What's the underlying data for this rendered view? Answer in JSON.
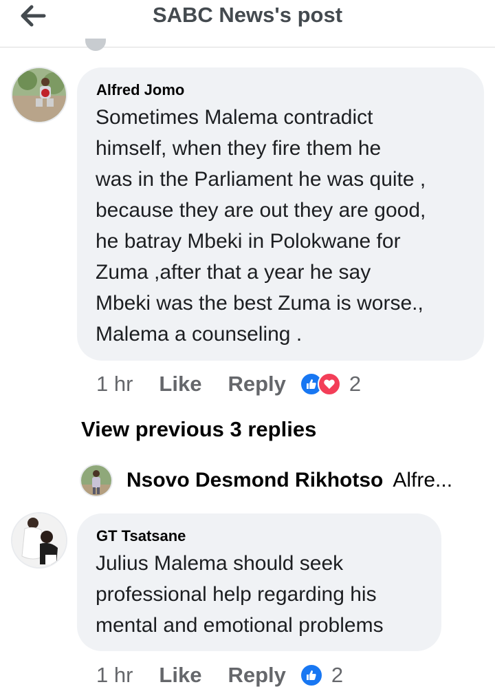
{
  "header": {
    "title": "SABC News's post",
    "back_icon": "arrow-left-icon"
  },
  "comments": [
    {
      "author": "Alfred Jomo",
      "text": "Sometimes Malema contradict\nhimself, when they fire them he\nwas in the Parliament he was quite ,\nbecause they are out they are good,\nhe batray Mbeki in Polokwane for\nZuma ,after that a year he say\nMbeki was the best Zuma is worse.,\nMalema a counseling .",
      "time": "1 hr",
      "like_label": "Like",
      "reply_label": "Reply",
      "reactions": [
        "like",
        "love"
      ],
      "reaction_count": "2"
    },
    {
      "author": "GT Tsatsane",
      "text": "Julius Malema should seek\nprofessional help regarding his\nmental and emotional problems",
      "time": "1 hr",
      "like_label": "Like",
      "reply_label": "Reply",
      "reactions": [
        "like"
      ],
      "reaction_count": "2"
    }
  ],
  "replies": {
    "view_previous_label": "View previous 3 replies",
    "preview_author": "Nsovo Desmond Rikhotso",
    "preview_snippet": "Alfre..."
  },
  "colors": {
    "bubble": "#f0f2f5",
    "meta_text": "#65676b",
    "like_blue": "#1877f2",
    "love_red": "#f33e58"
  }
}
